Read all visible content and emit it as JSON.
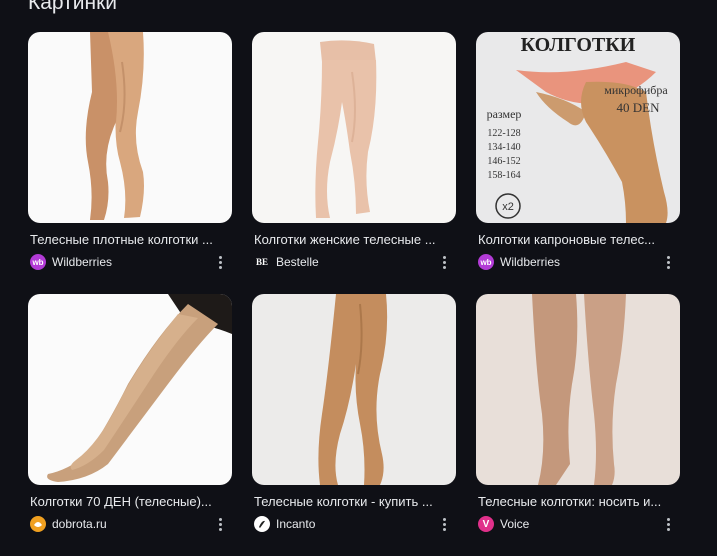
{
  "section": {
    "title": "Картинки"
  },
  "results": [
    {
      "caption": "Телесные плотные колготки ...",
      "source": "Wildberries",
      "source_icon": "wildberries-logo-icon",
      "icon_text": "wb",
      "icon_color": "#b23bd6"
    },
    {
      "caption": "Колготки женские телесные ...",
      "source": "Bestelle",
      "source_icon": "bestelle-logo-icon",
      "icon_text": "BE",
      "icon_color": "#0f1016"
    },
    {
      "caption": "Колготки капроновые телес...",
      "source": "Wildberries",
      "source_icon": "wildberries-logo-icon",
      "icon_text": "wb",
      "icon_color": "#b23bd6"
    },
    {
      "caption": "Колготки 70 ДЕН (телесные)...",
      "source": "dobrota.ru",
      "source_icon": "dobrota-logo-icon",
      "icon_text": "",
      "icon_color": "#f0a020"
    },
    {
      "caption": "Телесные колготки - купить ...",
      "source": "Incanto",
      "source_icon": "incanto-logo-icon",
      "icon_text": "",
      "icon_color": "#ffffff"
    },
    {
      "caption": "Телесные колготки: носить и...",
      "source": "Voice",
      "source_icon": "voice-logo-icon",
      "icon_text": "V",
      "icon_color": "#e0308a"
    }
  ],
  "package": {
    "brand": "КОЛГОТКИ",
    "material": "микрофибра",
    "density": "40 DEN",
    "size_label": "размер",
    "sizes": [
      "122-128",
      "134-140",
      "146-152",
      "158-164"
    ],
    "count_badge": "x2"
  }
}
